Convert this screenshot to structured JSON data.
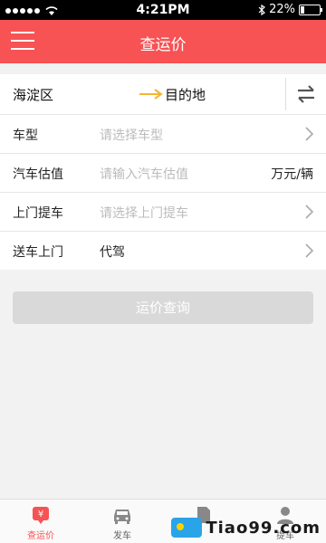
{
  "status_bar": {
    "time": "4:21PM",
    "battery": "22%",
    "battery_level": 0.22
  },
  "nav": {
    "title": "查运价"
  },
  "route": {
    "origin": "海淀区",
    "destination": "目的地"
  },
  "form": {
    "rows": [
      {
        "label": "车型",
        "placeholder": "请选择车型",
        "value": ""
      },
      {
        "label": "汽车估值",
        "placeholder": "请输入汽车估值",
        "value": "",
        "unit": "万元/辆"
      },
      {
        "label": "上门提车",
        "placeholder": "请选择上门提车",
        "value": ""
      },
      {
        "label": "送车上门",
        "placeholder": "",
        "value": "代驾"
      }
    ]
  },
  "query_button": {
    "label": "运价查询"
  },
  "tabs": [
    {
      "label": "查运价",
      "icon": "price-tag-icon",
      "active": true
    },
    {
      "label": "发车",
      "icon": "car-icon",
      "active": false
    },
    {
      "label": "",
      "icon": "document-icon",
      "active": false
    },
    {
      "label": "提车",
      "icon": "user-icon",
      "active": false
    }
  ],
  "watermark": {
    "text": "Tiao99.com"
  },
  "colors": {
    "brand": "#f75254",
    "arrow": "#f5b530"
  }
}
